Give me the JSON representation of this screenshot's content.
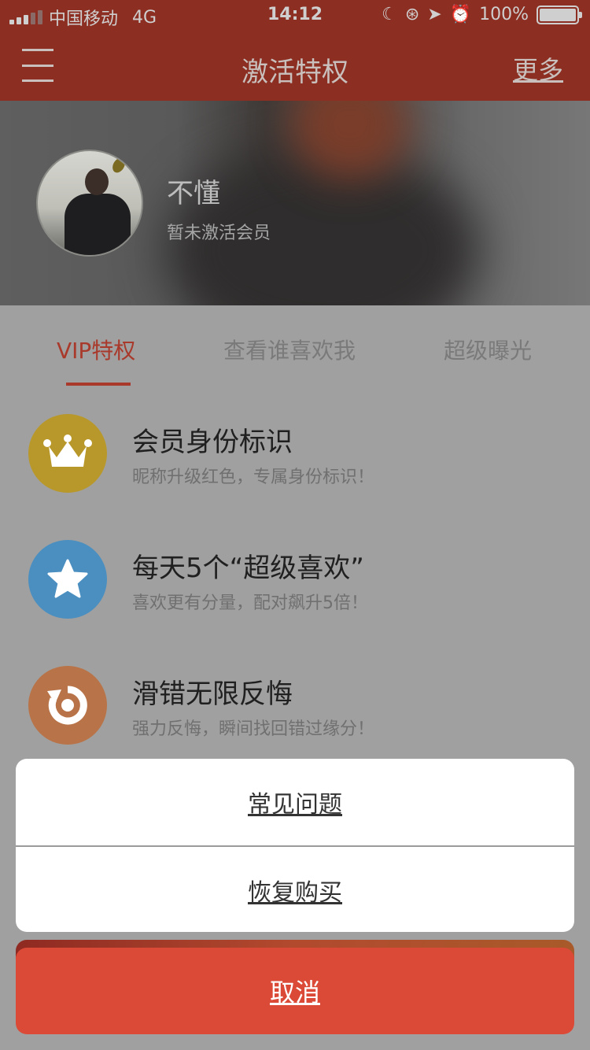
{
  "status_bar": {
    "carrier": "中国移动",
    "network": "4G",
    "time": "14:12",
    "battery": "100%"
  },
  "nav": {
    "title": "激活特权",
    "more": "更多"
  },
  "profile": {
    "name": "不懂",
    "status": "暂未激活会员"
  },
  "tabs": [
    {
      "label": "VIP特权",
      "active": true
    },
    {
      "label": "查看谁喜欢我",
      "active": false
    },
    {
      "label": "超级曝光",
      "active": false
    }
  ],
  "features": [
    {
      "icon": "crown-icon",
      "color": "#b8982a",
      "title": "会员身份标识",
      "desc": "昵称升级红色，专属身份标识！"
    },
    {
      "icon": "star-icon",
      "color": "#4a8fc0",
      "title": "每天5个“超级喜欢”",
      "desc": "喜欢更有分量，配对飙升5倍！"
    },
    {
      "icon": "undo-icon",
      "color": "#b87448",
      "title": "滑错无限反悔",
      "desc": "强力反悔，瞬间找回错过缘分！"
    }
  ],
  "action_sheet": {
    "items": [
      "常见问题",
      "恢复购买"
    ],
    "cancel": "取消"
  },
  "colors": {
    "brand": "#8c2e22",
    "accent": "#a8392b",
    "cancel": "#db4a36"
  }
}
